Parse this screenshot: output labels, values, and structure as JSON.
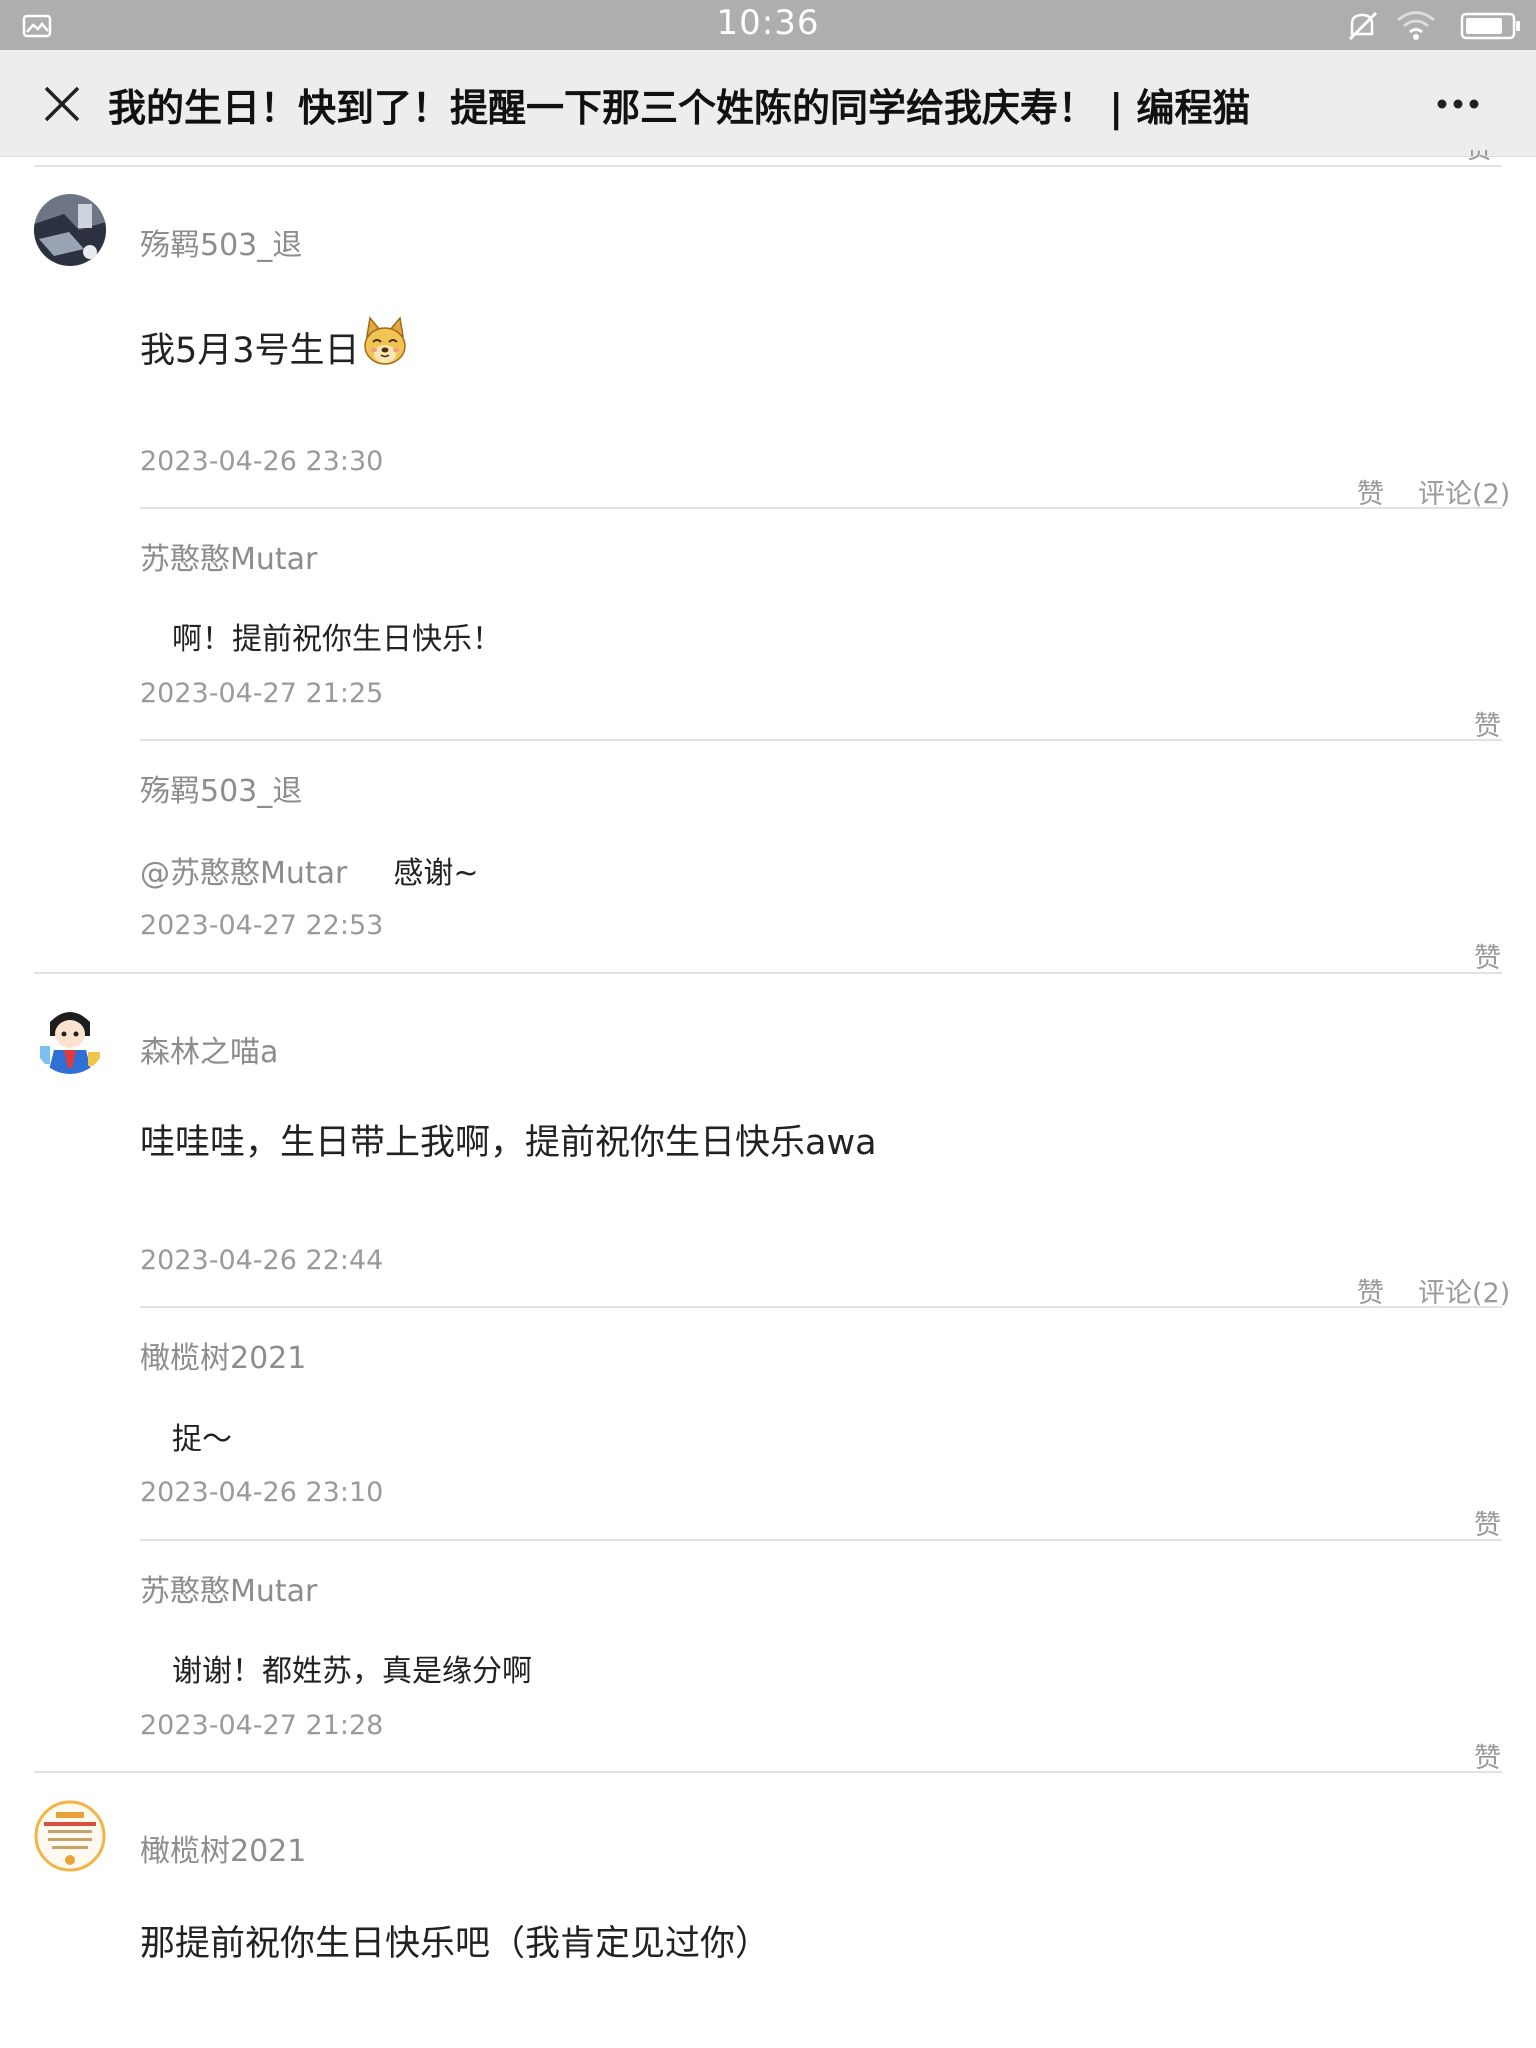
{
  "status_bar": {
    "time": "10:36",
    "icons": [
      "gallery-icon",
      "mute-icon",
      "wifi-icon",
      "battery-icon"
    ]
  },
  "header": {
    "title": "我的生日！快到了！提醒一下那三个姓陈的同学给我庆寿！ | 编程猫",
    "close_icon": "close-icon",
    "more_icon": "more-icon"
  },
  "comments": [
    {
      "user": "殇羁503_退",
      "text": "我5月3号生日",
      "emoji": "dog-emoji",
      "time": "2023-04-26  23:30",
      "like_label": "赞",
      "reply_label": "评论(2)",
      "replies": [
        {
          "user": "苏憨憨Mutar",
          "text": "啊！提前祝你生日快乐！",
          "time": "2023-04-27  21:25",
          "like_label": "赞"
        },
        {
          "user": "殇羁503_退",
          "mention": "@苏憨憨Mutar",
          "text": "感谢~",
          "time": "2023-04-27  22:53",
          "like_label": "赞"
        }
      ]
    },
    {
      "user": "森林之喵a",
      "text": "哇哇哇，生日带上我啊，提前祝你生日快乐awa",
      "time": "2023-04-26  22:44",
      "like_label": "赞",
      "reply_label": "评论(2)",
      "replies": [
        {
          "user": "橄榄树2021",
          "text": "捉～",
          "time": "2023-04-26  23:10",
          "like_label": "赞"
        },
        {
          "user": "苏憨憨Mutar",
          "text": "谢谢！都姓苏，真是缘分啊",
          "time": "2023-04-27  21:28",
          "like_label": "赞"
        }
      ]
    },
    {
      "user": "橄榄树2021",
      "text": "那提前祝你生日快乐吧（我肯定见过你）"
    }
  ]
}
